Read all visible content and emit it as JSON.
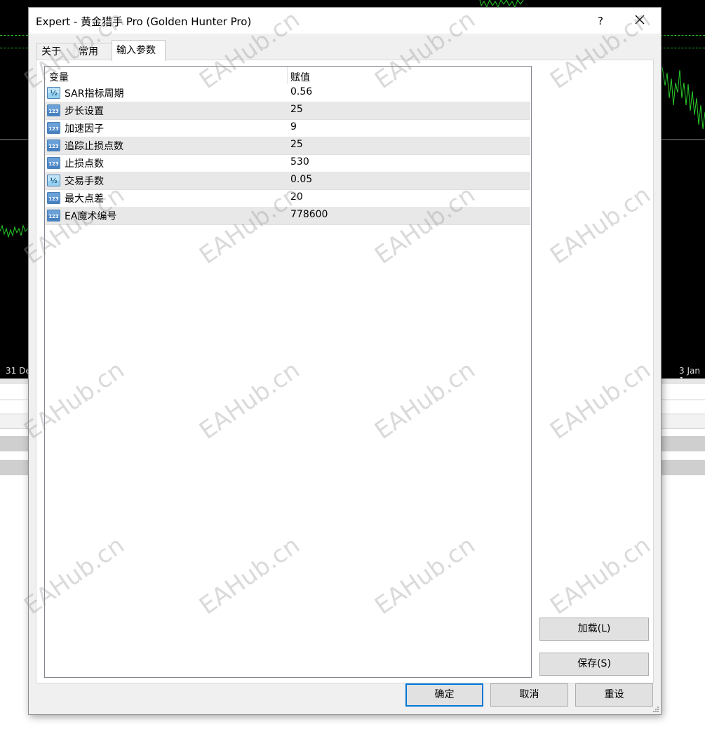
{
  "window": {
    "title": "Expert - 黄金猎手 Pro (Golden Hunter Pro)",
    "help": "?"
  },
  "tabs": [
    {
      "label": "关于"
    },
    {
      "label": "常用"
    },
    {
      "label": "输入参数"
    }
  ],
  "grid": {
    "headers": {
      "variable": "变量",
      "value": "赋值"
    },
    "rows": [
      {
        "name": "SAR指标周期",
        "value": "0.56",
        "type": "double"
      },
      {
        "name": "步长设置",
        "value": "25",
        "type": "int"
      },
      {
        "name": "加速因子",
        "value": "9",
        "type": "int"
      },
      {
        "name": "追踪止损点数",
        "value": "25",
        "type": "int"
      },
      {
        "name": "止损点数",
        "value": "530",
        "type": "int"
      },
      {
        "name": "交易手数",
        "value": "0.05",
        "type": "double"
      },
      {
        "name": "最大点差",
        "value": "20",
        "type": "int"
      },
      {
        "name": "EA魔术编号",
        "value": "778600",
        "type": "int"
      }
    ]
  },
  "buttons": {
    "load": "加载(L)",
    "save": "保存(S)",
    "ok": "确定",
    "cancel": "取消",
    "reset": "重设"
  },
  "chart": {
    "date_left": "31 De",
    "date_right": "3 Jan 1"
  },
  "watermark": "EAHub.cn",
  "colors": {
    "chart_bg": "#000000",
    "grid_dash": "#25c025",
    "focus": "#0078d7"
  }
}
